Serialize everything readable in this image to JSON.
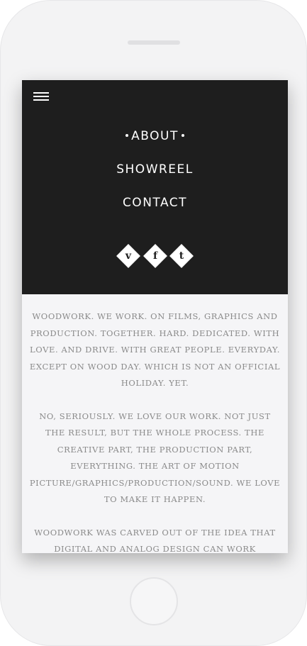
{
  "menu": {
    "icon": "hamburger-menu-icon",
    "items": [
      {
        "label": "ABOUT",
        "active": true
      },
      {
        "label": "SHOWREEL",
        "active": false
      },
      {
        "label": "CONTACT",
        "active": false
      }
    ]
  },
  "social": [
    {
      "icon": "vimeo-icon",
      "glyph": "v"
    },
    {
      "icon": "facebook-icon",
      "glyph": "f"
    },
    {
      "icon": "twitter-icon",
      "glyph": "t"
    }
  ],
  "about": {
    "paragraphs": [
      "WOODWORK. WE WORK. ON FILMS, GRAPHICS AND PRODUCTION. TOGETHER. HARD. DEDICATED. WITH LOVE. AND DRIVE. WITH GREAT PEOPLE. EVERYDAY. EXCEPT ON WOOD DAY. WHICH IS NOT AN OFFICIAL HOLIDAY. YET.",
      "NO, SERIOUSLY. WE LOVE OUR WORK. NOT JUST THE RESULT, BUT THE WHOLE PROCESS. THE CREATIVE PART, THE PRODUCTION PART, EVERYTHING. THE ART OF MOTION PICTURE/GRAPHICS/PRODUCTION/SOUND. WE LOVE TO MAKE IT HAPPEN.",
      "WOODWORK WAS CARVED OUT OF THE IDEA THAT DIGITAL AND ANALOG DESIGN CAN WORK TOGETHER HARMONIOUSLY. ORIGINALLY FOUNDED BY MARVIN KOPPEJAN AND BALSTER VAN DUIJN WITH A PASSION FOR"
    ]
  },
  "colors": {
    "nav_background": "#1e1e1e",
    "content_background": "#f5f5f7",
    "body_text": "#8a8a8a",
    "device_body": "#f3f3f4"
  }
}
